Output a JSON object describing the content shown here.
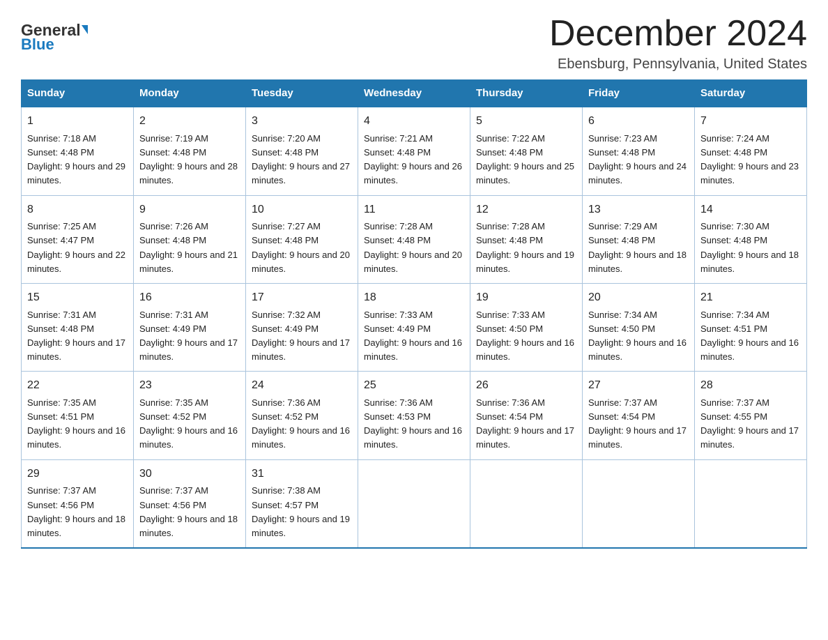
{
  "header": {
    "logo_general": "General",
    "logo_blue": "Blue",
    "title": "December 2024",
    "subtitle": "Ebensburg, Pennsylvania, United States"
  },
  "calendar": {
    "days_of_week": [
      "Sunday",
      "Monday",
      "Tuesday",
      "Wednesday",
      "Thursday",
      "Friday",
      "Saturday"
    ],
    "weeks": [
      [
        {
          "num": "1",
          "sunrise": "7:18 AM",
          "sunset": "4:48 PM",
          "daylight": "9 hours and 29 minutes."
        },
        {
          "num": "2",
          "sunrise": "7:19 AM",
          "sunset": "4:48 PM",
          "daylight": "9 hours and 28 minutes."
        },
        {
          "num": "3",
          "sunrise": "7:20 AM",
          "sunset": "4:48 PM",
          "daylight": "9 hours and 27 minutes."
        },
        {
          "num": "4",
          "sunrise": "7:21 AM",
          "sunset": "4:48 PM",
          "daylight": "9 hours and 26 minutes."
        },
        {
          "num": "5",
          "sunrise": "7:22 AM",
          "sunset": "4:48 PM",
          "daylight": "9 hours and 25 minutes."
        },
        {
          "num": "6",
          "sunrise": "7:23 AM",
          "sunset": "4:48 PM",
          "daylight": "9 hours and 24 minutes."
        },
        {
          "num": "7",
          "sunrise": "7:24 AM",
          "sunset": "4:48 PM",
          "daylight": "9 hours and 23 minutes."
        }
      ],
      [
        {
          "num": "8",
          "sunrise": "7:25 AM",
          "sunset": "4:47 PM",
          "daylight": "9 hours and 22 minutes."
        },
        {
          "num": "9",
          "sunrise": "7:26 AM",
          "sunset": "4:48 PM",
          "daylight": "9 hours and 21 minutes."
        },
        {
          "num": "10",
          "sunrise": "7:27 AM",
          "sunset": "4:48 PM",
          "daylight": "9 hours and 20 minutes."
        },
        {
          "num": "11",
          "sunrise": "7:28 AM",
          "sunset": "4:48 PM",
          "daylight": "9 hours and 20 minutes."
        },
        {
          "num": "12",
          "sunrise": "7:28 AM",
          "sunset": "4:48 PM",
          "daylight": "9 hours and 19 minutes."
        },
        {
          "num": "13",
          "sunrise": "7:29 AM",
          "sunset": "4:48 PM",
          "daylight": "9 hours and 18 minutes."
        },
        {
          "num": "14",
          "sunrise": "7:30 AM",
          "sunset": "4:48 PM",
          "daylight": "9 hours and 18 minutes."
        }
      ],
      [
        {
          "num": "15",
          "sunrise": "7:31 AM",
          "sunset": "4:48 PM",
          "daylight": "9 hours and 17 minutes."
        },
        {
          "num": "16",
          "sunrise": "7:31 AM",
          "sunset": "4:49 PM",
          "daylight": "9 hours and 17 minutes."
        },
        {
          "num": "17",
          "sunrise": "7:32 AM",
          "sunset": "4:49 PM",
          "daylight": "9 hours and 17 minutes."
        },
        {
          "num": "18",
          "sunrise": "7:33 AM",
          "sunset": "4:49 PM",
          "daylight": "9 hours and 16 minutes."
        },
        {
          "num": "19",
          "sunrise": "7:33 AM",
          "sunset": "4:50 PM",
          "daylight": "9 hours and 16 minutes."
        },
        {
          "num": "20",
          "sunrise": "7:34 AM",
          "sunset": "4:50 PM",
          "daylight": "9 hours and 16 minutes."
        },
        {
          "num": "21",
          "sunrise": "7:34 AM",
          "sunset": "4:51 PM",
          "daylight": "9 hours and 16 minutes."
        }
      ],
      [
        {
          "num": "22",
          "sunrise": "7:35 AM",
          "sunset": "4:51 PM",
          "daylight": "9 hours and 16 minutes."
        },
        {
          "num": "23",
          "sunrise": "7:35 AM",
          "sunset": "4:52 PM",
          "daylight": "9 hours and 16 minutes."
        },
        {
          "num": "24",
          "sunrise": "7:36 AM",
          "sunset": "4:52 PM",
          "daylight": "9 hours and 16 minutes."
        },
        {
          "num": "25",
          "sunrise": "7:36 AM",
          "sunset": "4:53 PM",
          "daylight": "9 hours and 16 minutes."
        },
        {
          "num": "26",
          "sunrise": "7:36 AM",
          "sunset": "4:54 PM",
          "daylight": "9 hours and 17 minutes."
        },
        {
          "num": "27",
          "sunrise": "7:37 AM",
          "sunset": "4:54 PM",
          "daylight": "9 hours and 17 minutes."
        },
        {
          "num": "28",
          "sunrise": "7:37 AM",
          "sunset": "4:55 PM",
          "daylight": "9 hours and 17 minutes."
        }
      ],
      [
        {
          "num": "29",
          "sunrise": "7:37 AM",
          "sunset": "4:56 PM",
          "daylight": "9 hours and 18 minutes."
        },
        {
          "num": "30",
          "sunrise": "7:37 AM",
          "sunset": "4:56 PM",
          "daylight": "9 hours and 18 minutes."
        },
        {
          "num": "31",
          "sunrise": "7:38 AM",
          "sunset": "4:57 PM",
          "daylight": "9 hours and 19 minutes."
        },
        null,
        null,
        null,
        null
      ]
    ]
  }
}
